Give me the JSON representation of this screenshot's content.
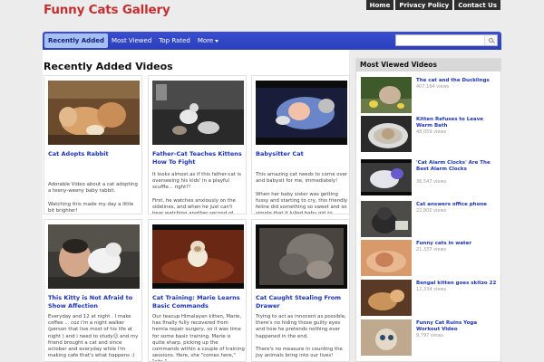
{
  "site": {
    "title": "Funny Cats Gallery",
    "top_links": [
      "Home",
      "Privacy Policy",
      "Contact Us"
    ]
  },
  "nav": {
    "tabs": [
      "Recently Added",
      "Most Viewed",
      "Top Rated",
      "More"
    ],
    "active_tab": "Recently Added",
    "search_placeholder": ""
  },
  "main": {
    "title": "Recently Added Videos",
    "videos": [
      {
        "title": "Cat Adopts Rabbit",
        "desc": "Adorable Video about a cat adopting a teeny-weeny baby rabbit.\n\nWatching this made my day a little bit brighter!"
      },
      {
        "title": "Father-Cat Teaches Kittens How To Fight",
        "desc": "It looks almost as if this father-cat is overseeing his kids' in a playful scuffle... right?!\n\nFirst, he watches anxiously on the sidelines, and when he just can't bear watching another second of"
      },
      {
        "title": "Babysitter Cat",
        "desc": "This amazing cat needs to come over and babysit for me, immediately!\n\nWhen her baby sister was getting fussy and starting to cry, this friendly feline did something so sweet and so simple that it lulled baby girl to"
      },
      {
        "title": "This Kitty is Not Afraid to Show Affection",
        "desc": "Everyday and 12 at night . I make coffee ... coz i'm a night walker (person that live most of his life at night ) and i need to study☺ and my friend brought a cat and since october and everyday while I'm making cafe that's what happens :)"
      },
      {
        "title": "Cat Training: Marie Learns Basic Commands",
        "desc": "Our teacup Himalayan kitten, Marie, has finally fully recovered from hernia repair surgery, so it was time for some basic training. Marie is quite sharp, picking up the commands within a couple of training sessions. Here, she \"comes here,\" \"sits,\""
      },
      {
        "title": "Cat Caught Stealing From Drawer",
        "desc": "Trying to act as innocent as possible, there's no hiding those guilty eyes and how he pretends nothing ever happened in the end.\n\nThere's no measure in counting the joy animals bring into our lives!"
      }
    ]
  },
  "sidebar": {
    "title": "Most Viewed Videos",
    "items": [
      {
        "title": "The cat and the Ducklings",
        "views": "407,164 views"
      },
      {
        "title": "Kitten Refuses to Leave Warm Bath",
        "views": "48,059 views"
      },
      {
        "title": "'Cat Alarm Clocks' Are The Best Alarm Clocks",
        "views": "36,547 views"
      },
      {
        "title": "Cat answers office phone",
        "views": "22,800 views"
      },
      {
        "title": "Funny cats in water",
        "views": "21,337 views"
      },
      {
        "title": "Bengal kitten goes skitzo 22",
        "views": "12,334 views"
      },
      {
        "title": "Funny Cat Ruins Yoga Workout Video",
        "views": "9,797 views"
      }
    ]
  },
  "colors": {
    "title_red": "#c62f2f",
    "nav_blue": "#2b3fbd",
    "link_blue": "#1b33b7",
    "active_tab_bg": "#a6c1f1"
  }
}
